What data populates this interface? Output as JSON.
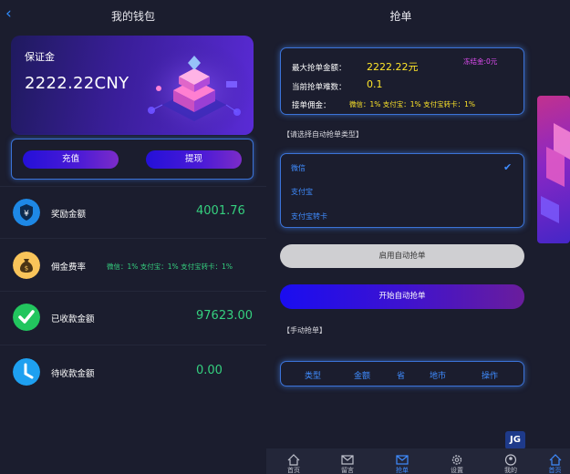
{
  "wallet": {
    "title": "我的钱包",
    "deposit_label": "保证金",
    "deposit_amount": "2222.22CNY",
    "recharge_button": "充值",
    "withdraw_button": "提现",
    "rows": [
      {
        "label": "奖励金额",
        "value": "4001.76",
        "icon": "yen-shield-icon",
        "color": "#1e88e5"
      },
      {
        "label": "佣金费率",
        "value": "微信：1% 支付宝：1% 支付宝转卡：1%",
        "icon": "money-bag-icon",
        "color": "#f9c45a"
      },
      {
        "label": "已收款金额",
        "value": "97623.00",
        "icon": "check-icon",
        "color": "#22c55e"
      },
      {
        "label": "待收款金额",
        "value": "0.00",
        "icon": "clock-icon",
        "color": "#1ea0f0"
      }
    ]
  },
  "grab": {
    "title": "抢单",
    "info": {
      "max_amount_label": "最大抢单金额：",
      "max_amount_value": "2222.22元",
      "difficulty_label": "当前抢单难数：",
      "difficulty_value": "0.1",
      "commission_label": "接单佣金：",
      "commission_value": "微信：1% 支付宝：1% 支付宝转卡：1%",
      "frozen": "冻结金:0元"
    },
    "auto_type_label": "【请选择自动抢单类型】",
    "types": [
      "微信",
      "支付宝",
      "支付宝转卡"
    ],
    "enable_auto_button": "启用自动抢单",
    "start_auto_button": "开始自动抢单",
    "manual_label": "【手动抢单】",
    "table_headers": [
      "类型",
      "金额",
      "省",
      "地市",
      "操作"
    ],
    "tabs": [
      {
        "label": "首页",
        "icon": "home-icon"
      },
      {
        "label": "留言",
        "icon": "mail-icon"
      },
      {
        "label": "抢单",
        "icon": "envelope-icon"
      },
      {
        "label": "设置",
        "icon": "gear-icon"
      },
      {
        "label": "我的",
        "icon": "user-icon"
      },
      {
        "label": "首页",
        "icon": "home-icon"
      }
    ],
    "watermark": "JG"
  },
  "colors": {
    "background": "#1b1d2e",
    "accent_blue": "#3f8cff",
    "value_green": "#35d07f",
    "value_yellow": "#ffe629",
    "frozen_pink": "#e34df5"
  }
}
